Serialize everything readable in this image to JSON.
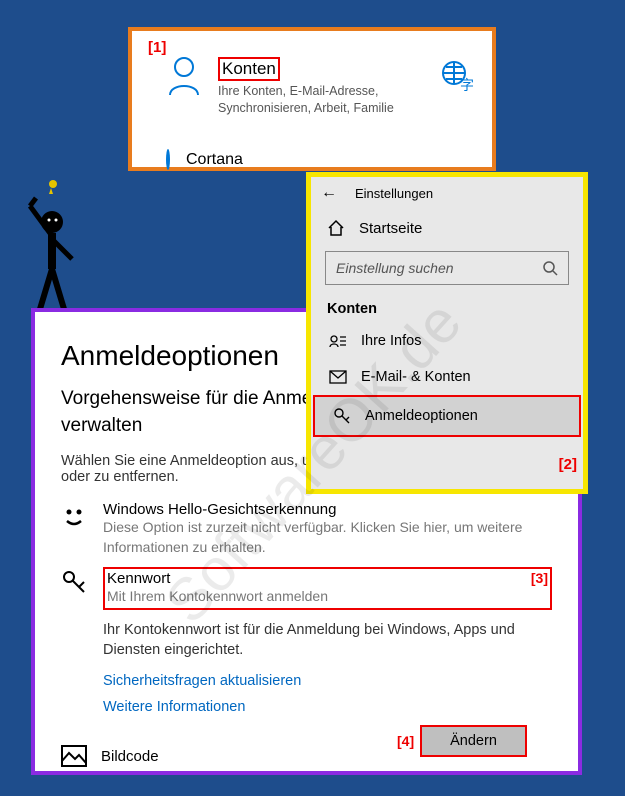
{
  "callouts": {
    "c1": "[1]",
    "c2": "[2]",
    "c3": "[3]",
    "c4": "[4]"
  },
  "panel1": {
    "title": "Konten",
    "desc": "Ihre Konten, E-Mail-Adresse, Synchronisieren, Arbeit, Familie",
    "cortana": "Cortana"
  },
  "panel2": {
    "header": "Einstellungen",
    "home": "Startseite",
    "search_placeholder": "Einstellung suchen",
    "section": "Konten",
    "items": [
      {
        "label": "Ihre Infos"
      },
      {
        "label": "E-Mail- & Konten"
      },
      {
        "label": "Anmeldeoptionen"
      }
    ]
  },
  "panel3": {
    "title": "Anmeldeoptionen",
    "subtitle": "Vorgehensweise für die Anmeldung bei Ihrem Gerät verwalten",
    "desc": "Wählen Sie eine Anmeldeoption aus, um sie hinzuzufügen, zu ändern oder zu entfernen.",
    "hello": {
      "title": "Windows Hello-Gesichtserkennung",
      "sub": "Diese Option ist zurzeit nicht verfügbar. Klicken Sie hier, um weitere Informationen zu erhalten."
    },
    "password": {
      "title": "Kennwort",
      "sub": "Mit Ihrem Kontokennwort anmelden",
      "info": "Ihr Kontokennwort ist für die Anmeldung bei Windows, Apps und Diensten eingerichtet.",
      "link1": "Sicherheitsfragen aktualisieren",
      "link2": "Weitere Informationen",
      "button": "Ändern"
    },
    "bildcode": "Bildcode"
  },
  "watermark": "SoftwareOK.de"
}
